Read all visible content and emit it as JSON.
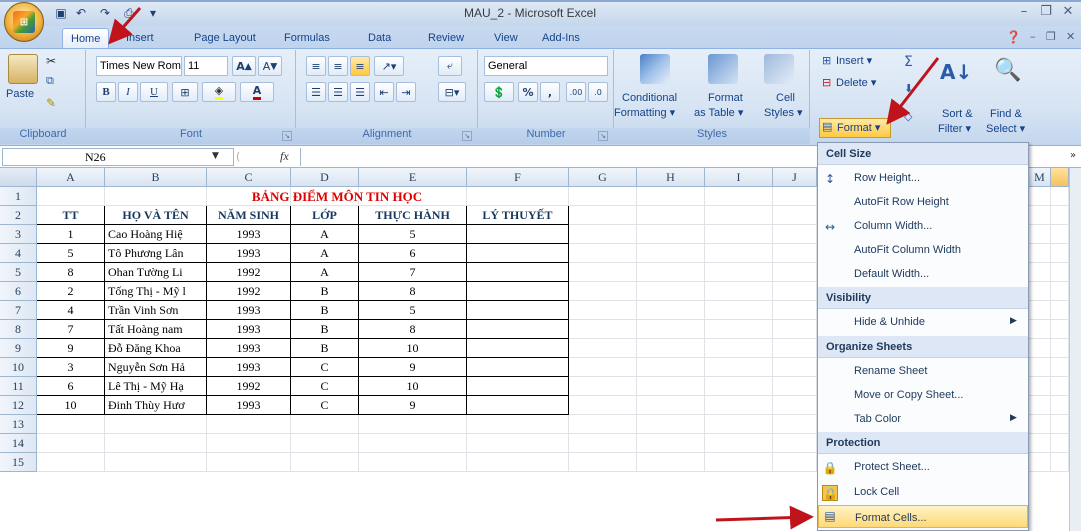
{
  "window": {
    "title": "MAU_2 - Microsoft Excel",
    "qat_icons": [
      "save-icon",
      "undo-icon",
      "redo-icon",
      "print-preview-icon",
      "customize-icon"
    ]
  },
  "tabs": [
    "Home",
    "Insert",
    "Page Layout",
    "Formulas",
    "Data",
    "Review",
    "View",
    "Add-Ins"
  ],
  "ribbon": {
    "clipboard": {
      "label": "Clipboard",
      "paste": "Paste"
    },
    "font": {
      "label": "Font",
      "font_name": "Times New Rom",
      "font_size": "11",
      "bold": "B",
      "italic": "I",
      "underline": "U"
    },
    "alignment": {
      "label": "Alignment"
    },
    "number": {
      "label": "Number",
      "format": "General",
      "percent": "%",
      "comma": ",",
      "inc_dec": ".00",
      "dec_dec": ".0"
    },
    "styles": {
      "label": "Styles",
      "conditional": "Conditional",
      "conditional2": "Formatting ▾",
      "format": "Format",
      "format2": "as Table ▾",
      "cell": "Cell",
      "cell2": "Styles ▾"
    },
    "cells": {
      "insert": "Insert ▾",
      "delete": "Delete ▾",
      "format": "Format ▾"
    },
    "editing": {
      "sort": "Sort &",
      "sort2": "Filter ▾",
      "find": "Find &",
      "find2": "Select ▾"
    }
  },
  "formula_bar": {
    "name_box": "N26",
    "fx": "fx"
  },
  "columns": [
    "A",
    "B",
    "C",
    "D",
    "E",
    "F",
    "G",
    "H",
    "I",
    "J",
    "M"
  ],
  "rows": [
    "1",
    "2",
    "3",
    "4",
    "5",
    "6",
    "7",
    "8",
    "9",
    "10",
    "11",
    "12",
    "13",
    "14",
    "15"
  ],
  "sheet": {
    "title": "BẢNG ĐIỂM MÔN TIN HỌC",
    "headers": [
      "TT",
      "HỌ VÀ TÊN",
      "NĂM SINH",
      "LỚP",
      "THỰC HÀNH",
      "LÝ THUYẾT"
    ],
    "data": [
      [
        "1",
        "Cao Hoàng Hiệ",
        "1993",
        "A",
        "5",
        ""
      ],
      [
        "5",
        "Tô Phương Lân",
        "1993",
        "A",
        "6",
        ""
      ],
      [
        "8",
        "Ohan Tường Li",
        "1992",
        "A",
        "7",
        ""
      ],
      [
        "2",
        "Tống Thị - Mỹ l",
        "1992",
        "B",
        "8",
        ""
      ],
      [
        "4",
        "Trần Vinh Sơn",
        "1993",
        "B",
        "5",
        ""
      ],
      [
        "7",
        "Tất Hoàng nam",
        "1993",
        "B",
        "8",
        ""
      ],
      [
        "9",
        "Đỗ Đăng Khoa",
        "1993",
        "B",
        "10",
        ""
      ],
      [
        "3",
        "Nguyễn Sơn Hả",
        "1993",
        "C",
        "9",
        ""
      ],
      [
        "6",
        "Lê Thị - Mỹ Hạ",
        "1992",
        "C",
        "10",
        ""
      ],
      [
        "10",
        "Đinh Thùy Hươ",
        "1993",
        "C",
        "9",
        ""
      ]
    ]
  },
  "format_menu": {
    "cell_size": "Cell Size",
    "row_height": "Row Height...",
    "autofit_row": "AutoFit Row Height",
    "col_width": "Column Width...",
    "autofit_col": "AutoFit Column Width",
    "default_width": "Default Width...",
    "visibility": "Visibility",
    "hide_unhide": "Hide & Unhide",
    "organize": "Organize Sheets",
    "rename": "Rename Sheet",
    "move_copy": "Move or Copy Sheet...",
    "tab_color": "Tab Color",
    "protection": "Protection",
    "protect": "Protect Sheet...",
    "lock": "Lock Cell",
    "format_cells": "Format Cells..."
  },
  "colors": {
    "accent_red": "#c0141c",
    "highlight": "#ffd977",
    "ribbon_blue": "#c4d7ee"
  }
}
